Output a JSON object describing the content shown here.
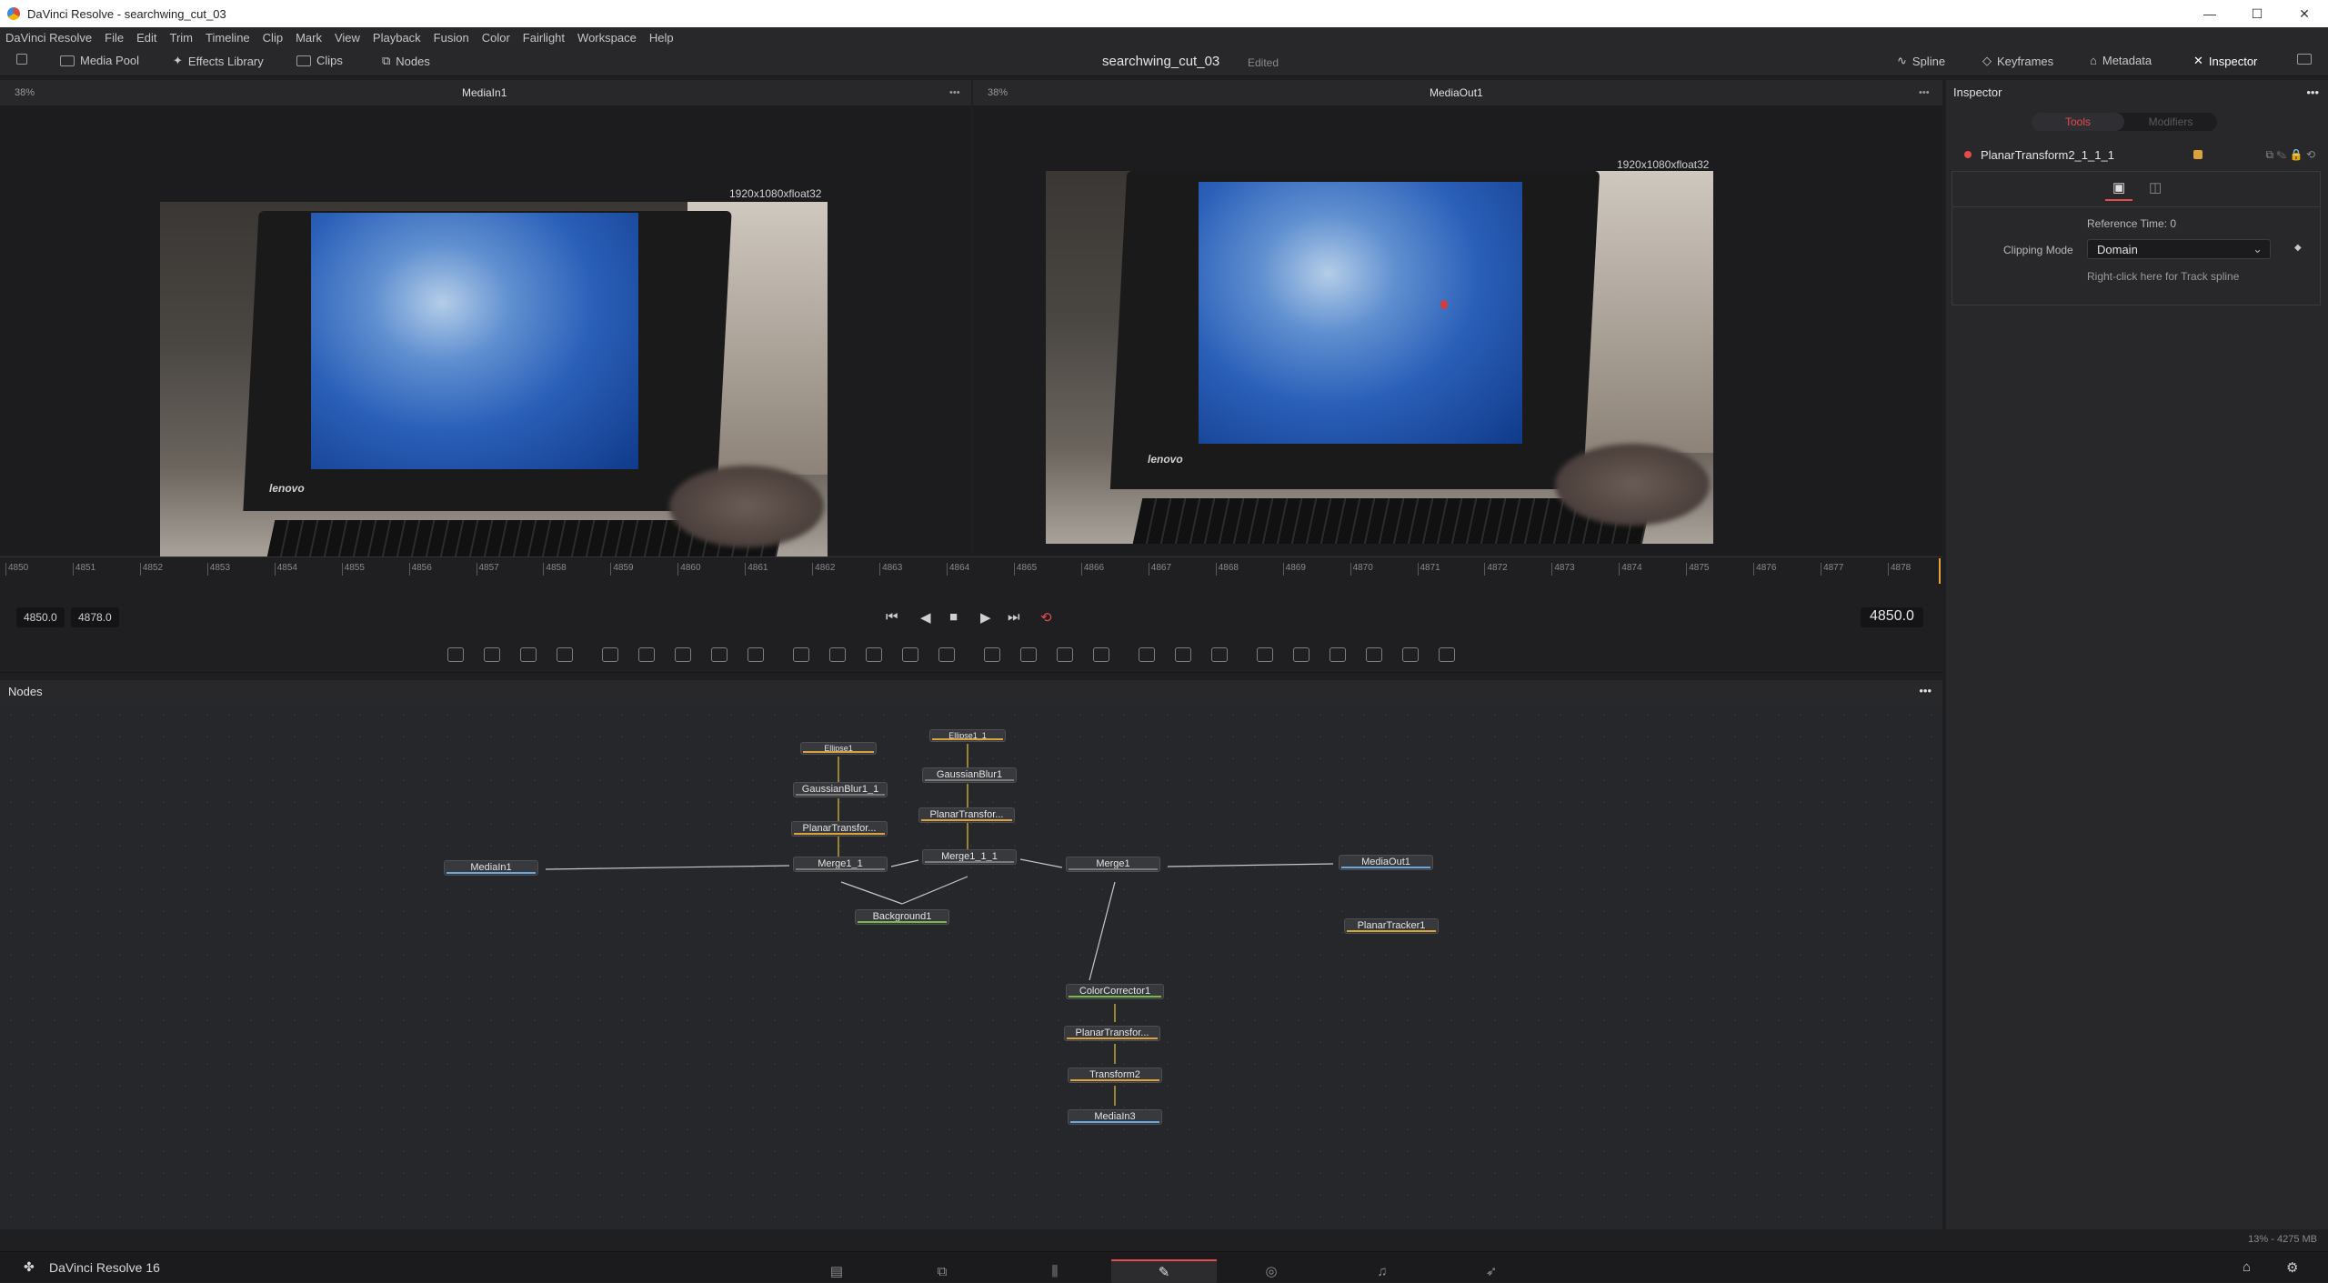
{
  "window": {
    "title": "DaVinci Resolve - searchwing_cut_03",
    "controls": [
      "—",
      "☐",
      "✕"
    ]
  },
  "menu": [
    "DaVinci Resolve",
    "File",
    "Edit",
    "Trim",
    "Timeline",
    "Clip",
    "Mark",
    "View",
    "Playback",
    "Fusion",
    "Color",
    "Fairlight",
    "Workspace",
    "Help"
  ],
  "toolbar": {
    "media_pool": "Media Pool",
    "effects_library": "Effects Library",
    "clips": "Clips",
    "nodes": "Nodes",
    "project": "searchwing_cut_03",
    "status": "Edited",
    "spline": "Spline",
    "keyframes": "Keyframes",
    "metadata": "Metadata",
    "inspector": "Inspector"
  },
  "viewer_left": {
    "zoom": "38%",
    "name": "MediaIn1",
    "resolution": "1920x1080xfloat32",
    "brand": "lenovo"
  },
  "viewer_right": {
    "zoom": "38%",
    "name": "MediaOut1",
    "resolution": "1920x1080xfloat32",
    "brand": "lenovo"
  },
  "ruler": {
    "ticks": [
      "4850",
      "4851",
      "4852",
      "4853",
      "4854",
      "4855",
      "4856",
      "4857",
      "4858",
      "4859",
      "4860",
      "4861",
      "4862",
      "4863",
      "4864",
      "4865",
      "4866",
      "4867",
      "4868",
      "4869",
      "4870",
      "4871",
      "4872",
      "4873",
      "4874",
      "4875",
      "4876",
      "4877",
      "4878"
    ]
  },
  "transport": {
    "start": "4850.0",
    "end": "4878.0",
    "current": "4850.0"
  },
  "nodes_panel": {
    "title": "Nodes"
  },
  "nodes": [
    {
      "label": "Ellipse1",
      "color": "#d9a23b"
    },
    {
      "label": "Ellipse1_1",
      "color": "#d9a23b"
    },
    {
      "label": "GaussianBlur1_1",
      "color": "#7a7a7a"
    },
    {
      "label": "GaussianBlur1",
      "color": "#7a7a7a"
    },
    {
      "label": "PlanarTransfor...",
      "color": "#d9a23b"
    },
    {
      "label": "PlanarTransfor...",
      "color": "#d9a23b"
    },
    {
      "label": "MediaIn1",
      "color": "#6aa8e0"
    },
    {
      "label": "Merge1_1",
      "color": "#7a7a7a"
    },
    {
      "label": "Merge1_1_1",
      "color": "#7a7a7a"
    },
    {
      "label": "Merge1",
      "color": "#7a7a7a"
    },
    {
      "label": "MediaOut1",
      "color": "#6aa8e0"
    },
    {
      "label": "Background1",
      "color": "#7ab84a"
    },
    {
      "label": "PlanarTracker1",
      "color": "#d9a23b"
    },
    {
      "label": "ColorCorrector1",
      "color": "#7ab84a"
    },
    {
      "label": "PlanarTransfor...",
      "color": "#d9a23b"
    },
    {
      "label": "Transform2",
      "color": "#d9a23b"
    },
    {
      "label": "MediaIn3",
      "color": "#6aa8e0"
    }
  ],
  "inspector": {
    "title": "Inspector",
    "tabs": [
      "Tools",
      "Modifiers"
    ],
    "tool_name": "PlanarTransform2_1_1_1",
    "reference_time": "Reference Time: 0",
    "clipping_label": "Clipping Mode",
    "clipping_value": "Domain",
    "hint": "Right-click here for Track spline"
  },
  "status": {
    "memory": "13% - 4275 MB"
  },
  "footer": {
    "app": "DaVinci Resolve 16",
    "pages": [
      "▤",
      "⧉",
      "⫼",
      "✎",
      "◎",
      "♫",
      "➶"
    ]
  }
}
